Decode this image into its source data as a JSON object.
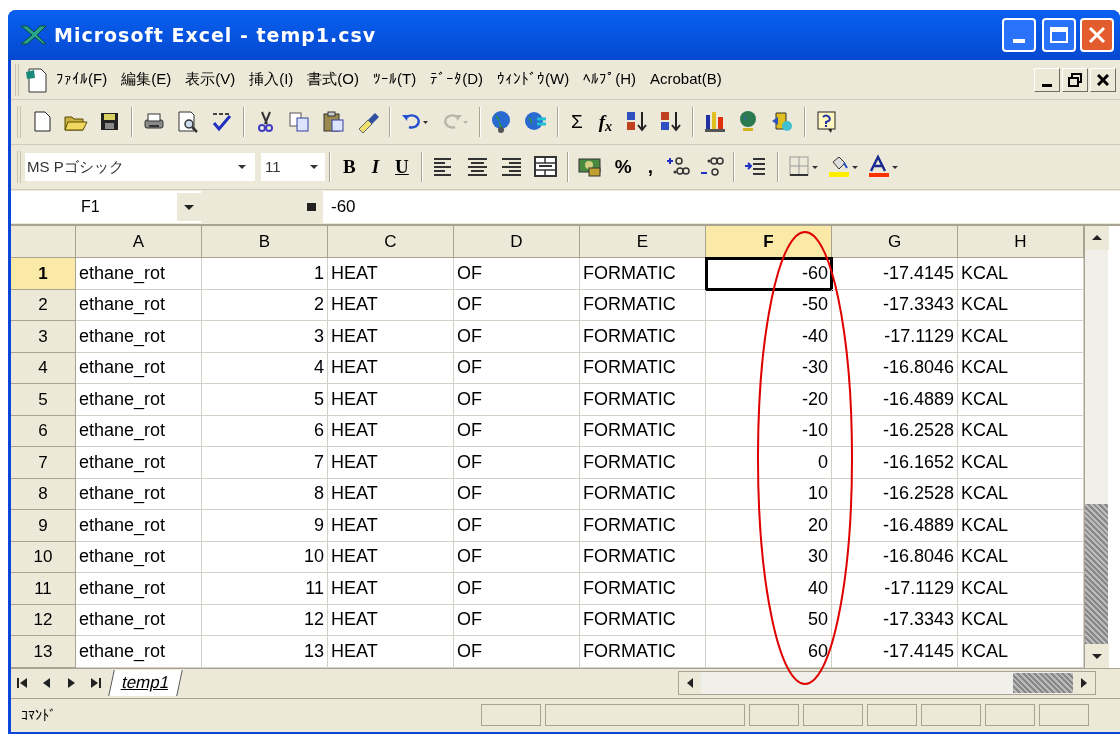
{
  "window": {
    "title": "Microsoft Excel - temp1.csv"
  },
  "menu": [
    "ﾌｧｲﾙ(F)",
    "編集(E)",
    "表示(V)",
    "挿入(I)",
    "書式(O)",
    "ﾂｰﾙ(T)",
    "ﾃﾞｰﾀ(D)",
    "ｳｨﾝﾄﾞｳ(W)",
    "ﾍﾙﾌﾟ(H)",
    "Acrobat(B)"
  ],
  "standard_toolbar": {
    "sum_label": "Σ",
    "function_label": "f$_{x}$"
  },
  "formatting_toolbar": {
    "font": "MS Pゴシック",
    "size": "11",
    "bold_label": "B",
    "italic_label": "I",
    "underline_label": "U",
    "percent_label": "%",
    "comma_label": ","
  },
  "formula_bar": {
    "name_box": "F1",
    "value": "-60"
  },
  "columns": [
    {
      "label": "A",
      "selected": false
    },
    {
      "label": "B",
      "selected": false
    },
    {
      "label": "C",
      "selected": false
    },
    {
      "label": "D",
      "selected": false
    },
    {
      "label": "E",
      "selected": false
    },
    {
      "label": "F",
      "selected": true
    },
    {
      "label": "G",
      "selected": false
    },
    {
      "label": "H",
      "selected": false
    }
  ],
  "rows": [
    {
      "number": "1",
      "selected": true,
      "cells": [
        "ethane_rot",
        "1",
        "HEAT",
        "OF",
        "FORMATIC",
        "-60",
        "-17.4145",
        "KCAL"
      ]
    },
    {
      "number": "2",
      "selected": false,
      "cells": [
        "ethane_rot",
        "2",
        "HEAT",
        "OF",
        "FORMATIC",
        "-50",
        "-17.3343",
        "KCAL"
      ]
    },
    {
      "number": "3",
      "selected": false,
      "cells": [
        "ethane_rot",
        "3",
        "HEAT",
        "OF",
        "FORMATIC",
        "-40",
        "-17.1129",
        "KCAL"
      ]
    },
    {
      "number": "4",
      "selected": false,
      "cells": [
        "ethane_rot",
        "4",
        "HEAT",
        "OF",
        "FORMATIC",
        "-30",
        "-16.8046",
        "KCAL"
      ]
    },
    {
      "number": "5",
      "selected": false,
      "cells": [
        "ethane_rot",
        "5",
        "HEAT",
        "OF",
        "FORMATIC",
        "-20",
        "-16.4889",
        "KCAL"
      ]
    },
    {
      "number": "6",
      "selected": false,
      "cells": [
        "ethane_rot",
        "6",
        "HEAT",
        "OF",
        "FORMATIC",
        "-10",
        "-16.2528",
        "KCAL"
      ]
    },
    {
      "number": "7",
      "selected": false,
      "cells": [
        "ethane_rot",
        "7",
        "HEAT",
        "OF",
        "FORMATIC",
        "0",
        "-16.1652",
        "KCAL"
      ]
    },
    {
      "number": "8",
      "selected": false,
      "cells": [
        "ethane_rot",
        "8",
        "HEAT",
        "OF",
        "FORMATIC",
        "10",
        "-16.2528",
        "KCAL"
      ]
    },
    {
      "number": "9",
      "selected": false,
      "cells": [
        "ethane_rot",
        "9",
        "HEAT",
        "OF",
        "FORMATIC",
        "20",
        "-16.4889",
        "KCAL"
      ]
    },
    {
      "number": "10",
      "selected": false,
      "cells": [
        "ethane_rot",
        "10",
        "HEAT",
        "OF",
        "FORMATIC",
        "30",
        "-16.8046",
        "KCAL"
      ]
    },
    {
      "number": "11",
      "selected": false,
      "cells": [
        "ethane_rot",
        "11",
        "HEAT",
        "OF",
        "FORMATIC",
        "40",
        "-17.1129",
        "KCAL"
      ]
    },
    {
      "number": "12",
      "selected": false,
      "cells": [
        "ethane_rot",
        "12",
        "HEAT",
        "OF",
        "FORMATIC",
        "50",
        "-17.3343",
        "KCAL"
      ]
    },
    {
      "number": "13",
      "selected": false,
      "cells": [
        "ethane_rot",
        "13",
        "HEAT",
        "OF",
        "FORMATIC",
        "60",
        "-17.4145",
        "KCAL"
      ]
    }
  ],
  "sheet_tabs": [
    {
      "label": "temp1",
      "selected": true
    }
  ],
  "status_bar": {
    "mode": "ｺﾏﾝﾄﾞ"
  }
}
